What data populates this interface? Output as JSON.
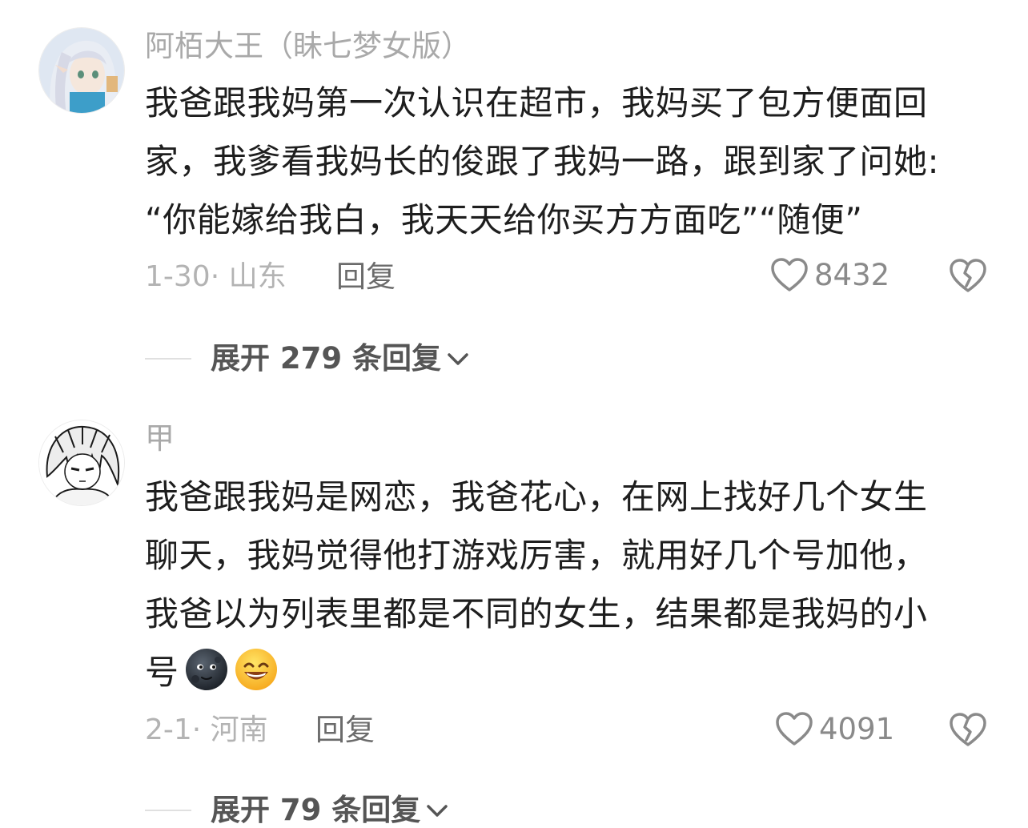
{
  "comments": [
    {
      "username": "阿栢大王（眛七梦女版）",
      "lines": [
        "我爸跟我妈第一次认识在超市，我妈买了包方便面回",
        "家，我爹看我妈长的俊跟了我妈一路，跟到家了问她:",
        "“你能嫁给我白，我天天给你买方方面吃”“随便”"
      ],
      "date_location": "1-30· 山东",
      "reply_label": "回复",
      "like_count": "8432",
      "expand_label": "展开 279 条回复"
    },
    {
      "username": "甲",
      "lines": [
        "我爸跟我妈是网恋，我爸花心，在网上找好几个女生",
        "聊天，我妈觉得他打游戏厉害，就用好几个号加他，",
        "我爸以为列表里都是不同的女生，结果都是我妈的小",
        "号"
      ],
      "emojis": [
        "new-moon-face-icon",
        "grinning-face-icon"
      ],
      "date_location": "2-1· 河南",
      "reply_label": "回复",
      "like_count": "4091",
      "expand_label": "展开 79 条回复"
    }
  ],
  "colors": {
    "username": "#a9a9a9",
    "body": "#1e1e1e",
    "meta": "#b3b3b3",
    "reply": "#6b6b6b",
    "like_count": "#8a8a8a",
    "expand": "#555555"
  }
}
